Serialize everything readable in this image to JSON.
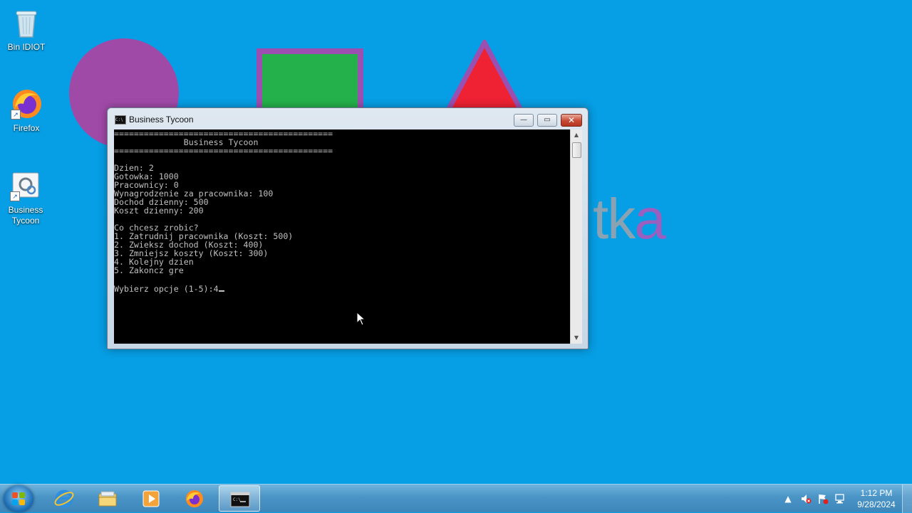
{
  "wallpaper": {
    "text_part1": "tk",
    "text_part2": "a"
  },
  "desktop": {
    "icons": [
      {
        "label": "Bin IDIOT",
        "icon": "recycle-bin-icon"
      },
      {
        "label": "Firefox",
        "icon": "firefox-icon"
      },
      {
        "label": "Business Tycoon",
        "icon": "app-settings-icon"
      }
    ]
  },
  "window": {
    "title": "Business Tycoon",
    "controls": {
      "minimize": "—",
      "maximize": "▭",
      "close": "✕"
    }
  },
  "console": {
    "lines": [
      "============================================",
      "              Business Tycoon",
      "============================================",
      "",
      "Dzien: 2",
      "Gotowka: 1000",
      "Pracownicy: 0",
      "Wynagrodzenie za pracownika: 100",
      "Dochod dzienny: 500",
      "Koszt dzienny: 200",
      "",
      "Co chcesz zrobic?",
      "1. Zatrudnij pracownika (Koszt: 500)",
      "2. Zwieksz dochod (Koszt: 400)",
      "3. Zmniejsz koszty (Koszt: 300)",
      "4. Kolejny dzien",
      "5. Zakoncz gre",
      "",
      "Wybierz opcje (1-5):4"
    ]
  },
  "taskbar": {
    "items": [
      {
        "name": "internet-explorer",
        "active": false
      },
      {
        "name": "file-explorer",
        "active": false
      },
      {
        "name": "media-player",
        "active": false
      },
      {
        "name": "firefox",
        "active": false
      },
      {
        "name": "command-prompt",
        "active": true
      }
    ],
    "clock": {
      "time": "1:12 PM",
      "date": "9/28/2024"
    }
  },
  "colors": {
    "desktop": "#069ee4",
    "console_bg": "#000000",
    "console_fg": "#c0c0c0"
  }
}
